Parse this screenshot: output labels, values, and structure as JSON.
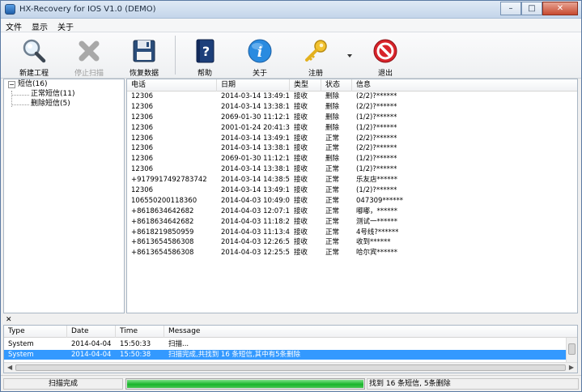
{
  "window": {
    "title": "HX-Recovery for IOS V1.0 (DEMO)",
    "minimize": "–",
    "maximize": "□",
    "close": "✕"
  },
  "menu": [
    "文件",
    "显示",
    "关于"
  ],
  "toolbar": {
    "new_project": "新建工程",
    "stop_scan": "停止扫描",
    "restore_data": "恢复数据",
    "help": "帮助",
    "about": "关于",
    "register": "注册",
    "exit": "退出"
  },
  "tree": {
    "toggle": "−",
    "root": "短信(16)",
    "children": [
      "正常短信(11)",
      "删除短信(5)"
    ]
  },
  "table": {
    "columns": [
      "电话",
      "日期",
      "类型",
      "状态",
      "信息"
    ],
    "rows": [
      [
        "12306",
        "2014-03-14 13:49:12",
        "接收",
        "删除",
        "(2/2)?******"
      ],
      [
        "12306",
        "2014-03-14 13:38:17",
        "接收",
        "删除",
        "(2/2)?******"
      ],
      [
        "12306",
        "2069-01-30 11:12:17",
        "接收",
        "删除",
        "(1/2)?******"
      ],
      [
        "12306",
        "2001-01-24 20:41:36",
        "接收",
        "删除",
        "(1/2)?******"
      ],
      [
        "12306",
        "2014-03-14 13:49:12",
        "接收",
        "正常",
        "(2/2)?******"
      ],
      [
        "12306",
        "2014-03-14 13:38:17",
        "接收",
        "正常",
        "(2/2)?******"
      ],
      [
        "12306",
        "2069-01-30 11:12:17",
        "接收",
        "删除",
        "(1/2)?******"
      ],
      [
        "12306",
        "2014-03-14 13:38:17",
        "接收",
        "正常",
        "(1/2)?******"
      ],
      [
        "+9179917492783742",
        "2014-03-14 14:38:58",
        "接收",
        "正常",
        "乐友店******"
      ],
      [
        "12306",
        "2014-03-14 13:49:12",
        "接收",
        "正常",
        "(1/2)?******"
      ],
      [
        "106550200118360",
        "2014-04-03 10:49:00",
        "接收",
        "正常",
        "047309******"
      ],
      [
        "+8618634642682",
        "2014-04-03 12:07:16",
        "接收",
        "正常",
        "嘟嘟，******"
      ],
      [
        "+8618634642682",
        "2014-04-03 11:18:23",
        "接收",
        "正常",
        "测试一******"
      ],
      [
        "+8618219850959",
        "2014-04-03 11:13:40",
        "接收",
        "正常",
        "4号线?******"
      ],
      [
        "+8613654586308",
        "2014-04-03 12:26:59",
        "接收",
        "正常",
        "收到******"
      ],
      [
        "+8613654586308",
        "2014-04-03 12:25:59",
        "接收",
        "正常",
        "哈尔宾******"
      ]
    ]
  },
  "log": {
    "close": "✕",
    "columns": [
      "Type",
      "Date",
      "Time",
      "Message"
    ],
    "rows": [
      [
        "System",
        "2014-04-04",
        "15:50:33",
        "扫描..."
      ],
      [
        "System",
        "2014-04-04",
        "15:50:38",
        "扫描完成,共找到 16 条短信,其中有5条删除"
      ]
    ],
    "selected_row": 1
  },
  "status": {
    "left": "扫描完成",
    "progress": 1.0,
    "right": "找到 16 条短信, 5条删除"
  },
  "colors": {
    "selection": "#3399ff",
    "progress": "#19b52c",
    "exit_red": "#d8232a",
    "about_blue": "#2a8be0"
  }
}
